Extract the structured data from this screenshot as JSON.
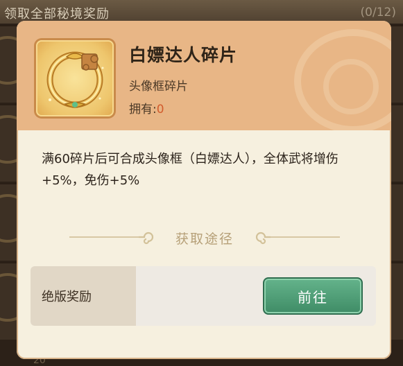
{
  "background": {
    "title": "领取全部秘境奖励",
    "count": "(0/12)",
    "bottom_number": "20"
  },
  "popup": {
    "item": {
      "name": "白嫖达人碎片",
      "type": "头像框碎片",
      "owned_label": "拥有:",
      "owned_value": "0",
      "icon": "avatar-frame-fragment-icon"
    },
    "description": "满60碎片后可合成头像框（白嫖达人），全体武将增伤+5%，免伤+5%",
    "divider_label": "获取途径",
    "sources": [
      {
        "label": "绝版奖励",
        "button": "前往"
      }
    ]
  },
  "colors": {
    "header_bg": "#e8b686",
    "body_bg": "#f6f0df",
    "accent_green": "#4c9c74",
    "owned_value": "#d25b2c"
  }
}
